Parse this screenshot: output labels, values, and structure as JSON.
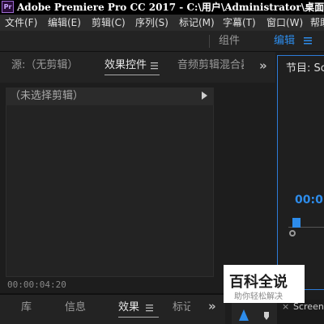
{
  "title_bar": {
    "app_icon": "Pr",
    "title": "Adobe Premiere Pro CC 2017 - C:\\用户\\Administrator\\桌面"
  },
  "menu": {
    "items": [
      "文件(F)",
      "编辑(E)",
      "剪辑(C)",
      "序列(S)",
      "标记(M)",
      "字幕(T)",
      "窗口(W)",
      "帮助"
    ]
  },
  "workspace": {
    "items": [
      "组件",
      "编辑"
    ],
    "active": "编辑",
    "menu_icon": "hamburger-icon",
    "active_color": "#2d8ceb"
  },
  "source_panel": {
    "tabs": [
      "源:（无剪辑）",
      "效果控件",
      "音频剪辑混合器"
    ],
    "active_tab": "效果控件",
    "overflow": "»",
    "no_clip_label": "（未选择剪辑）",
    "timecode": "00:00:04:20"
  },
  "program_panel": {
    "title": "节目: Sc",
    "timecode": "00:0",
    "accent": "#2d8ceb"
  },
  "lower_panel": {
    "tabs": [
      "库",
      "信息",
      "效果",
      "标记"
    ],
    "active_tab": "效果",
    "overflow": "»"
  },
  "watermark": {
    "title": "百科全说",
    "subtitle": "助你轻松解决"
  },
  "timeline_tab": {
    "close": "×",
    "label": "Screens"
  }
}
